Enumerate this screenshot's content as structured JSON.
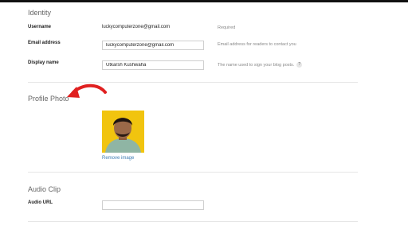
{
  "identity": {
    "title": "Identity",
    "username": {
      "label": "Username",
      "value": "luckycomputerzone@gmail.com",
      "hint": "Required"
    },
    "email": {
      "label": "Email address",
      "value": "luckycomputerzone@gmail.com",
      "hint": "Email address for readers to contact you"
    },
    "display_name": {
      "label": "Display name",
      "value": "Utkarsh Kushwaha",
      "hint": "The name used to sign your blog posts.",
      "help_icon": "?"
    }
  },
  "profile_photo": {
    "title": "Profile Photo",
    "remove_label": "Remove image"
  },
  "audio_clip": {
    "title": "Audio Clip",
    "url_label": "Audio URL",
    "url_value": ""
  },
  "colors": {
    "accent_link": "#3d7cb3",
    "annotation_arrow": "#e02020",
    "photo_bg": "#f1c40f"
  }
}
